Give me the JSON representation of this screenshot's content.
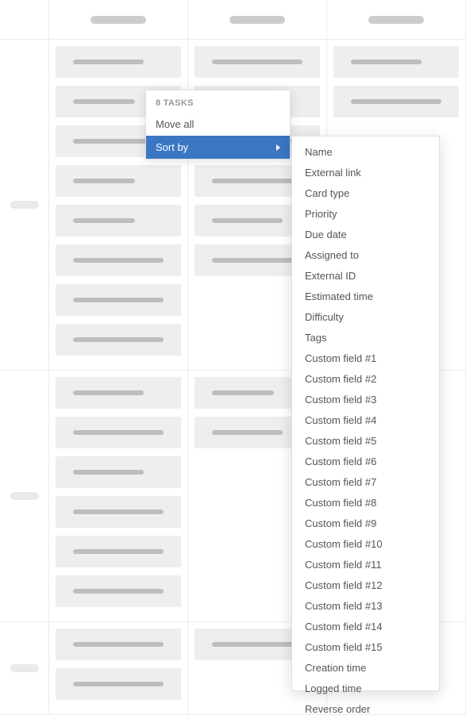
{
  "columns": [
    {
      "cards_per_row": [
        0,
        0,
        0
      ]
    },
    {
      "cards_per_row": [
        8,
        6,
        2
      ]
    },
    {
      "cards_per_row": [
        6,
        2,
        1
      ]
    },
    {
      "cards_per_row": [
        2,
        0,
        0
      ]
    }
  ],
  "row_labels": [
    "",
    "",
    "",
    ""
  ],
  "context_menu": {
    "header": "8 TASKS",
    "items": [
      {
        "label": "Move all",
        "active": false
      },
      {
        "label": "Sort by",
        "active": true,
        "has_submenu": true
      }
    ]
  },
  "sort_submenu": [
    "Name",
    "External link",
    "Card type",
    "Priority",
    "Due date",
    "Assigned to",
    "External ID",
    "Estimated time",
    "Difficulty",
    "Tags",
    "Custom field #1",
    "Custom field #2",
    "Custom field #3",
    "Custom field #4",
    "Custom field #5",
    "Custom field #6",
    "Custom field #7",
    "Custom field #8",
    "Custom field #9",
    "Custom field #10",
    "Custom field #11",
    "Custom field #12",
    "Custom field #13",
    "Custom field #14",
    "Custom field #15",
    "Creation time",
    "Logged time",
    "Reverse order"
  ]
}
